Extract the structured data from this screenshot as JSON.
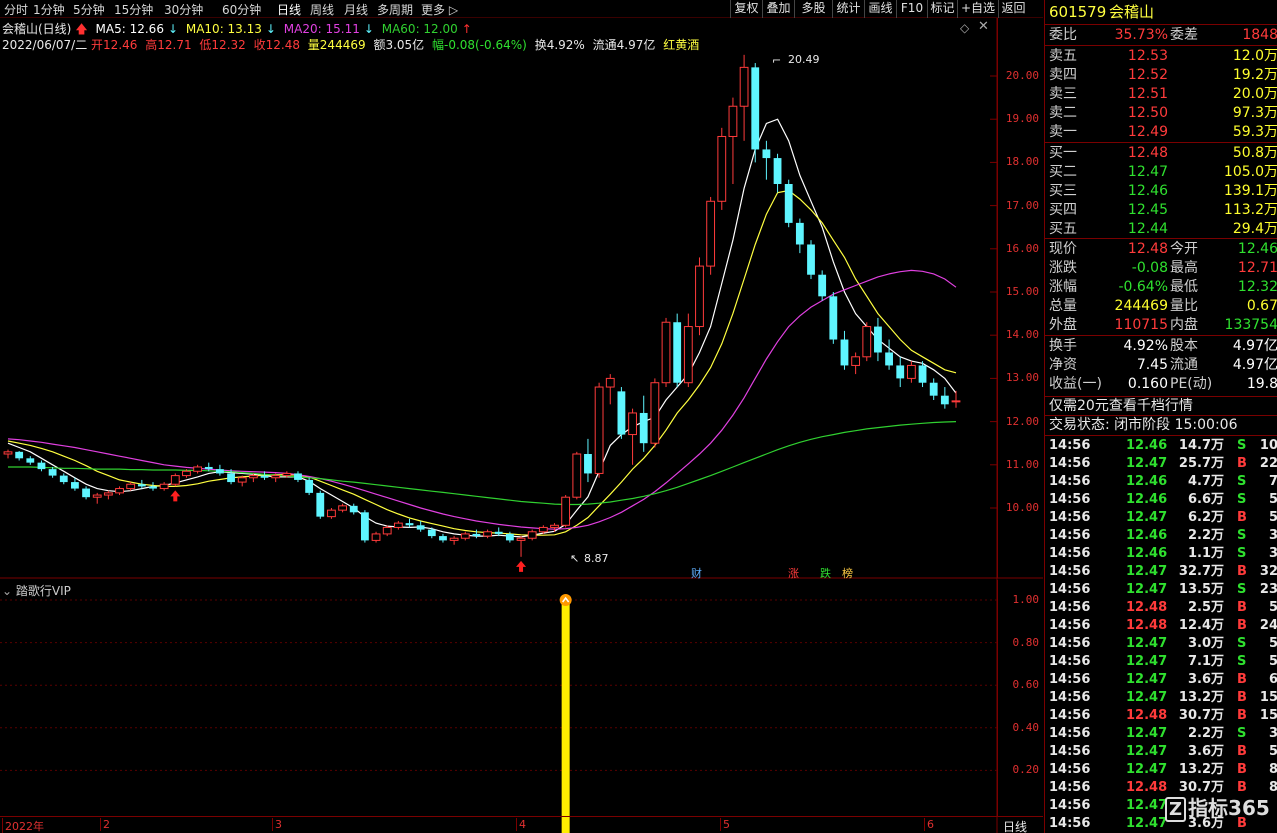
{
  "toolbar": {
    "periods": [
      "分时",
      "1分钟",
      "5分钟",
      "15分钟",
      "30分钟",
      "60分钟",
      "日线",
      "周线",
      "月线",
      "多周期",
      "更多"
    ],
    "active": "日线",
    "right_buttons": [
      "复权",
      "叠加",
      "多股",
      "统计",
      "画线",
      "F10",
      "标记",
      "+自选",
      "返回"
    ]
  },
  "info_line1": {
    "name": "会稽山(日线)",
    "ma5": "MA5: 12.66",
    "ma10": "MA10: 13.13",
    "ma20": "MA20: 15.11",
    "ma60": "MA60: 12.00"
  },
  "info_line2": {
    "date": "2022/06/07/二",
    "open": "开12.46",
    "high": "高12.71",
    "low": "低12.32",
    "close": "收12.48",
    "volume": "量244469",
    "amount": "额3.05亿",
    "change": "幅-0.08(-0.64%)",
    "turnover": "换4.92%",
    "float": "流通4.97亿",
    "concept": "红黄酒"
  },
  "price_axis": {
    "labels": [
      "20.00",
      "19.00",
      "18.00",
      "17.00",
      "16.00",
      "15.00",
      "14.00",
      "13.00",
      "12.00",
      "11.00",
      "10.00"
    ]
  },
  "annotations": {
    "high": "20.49",
    "low": "8.87",
    "events": [
      "财",
      "涨",
      "跌",
      "榜"
    ]
  },
  "indicator": {
    "name": "踏歌行VIP",
    "axis_labels": [
      "1.00",
      "0.80",
      "0.60",
      "0.40",
      "0.20"
    ]
  },
  "time_axis": {
    "labels": [
      "2022年",
      "2",
      "3",
      "4",
      "5",
      "6"
    ],
    "period": "日线"
  },
  "chart_data": {
    "type": "candlestick",
    "series_names": [
      "MA5",
      "MA10",
      "MA20",
      "MA60"
    ],
    "ylim": [
      8.6,
      20.8
    ],
    "candles": [
      [
        11.25,
        11.35,
        11.15,
        11.3
      ],
      [
        11.3,
        11.32,
        11.1,
        11.15
      ],
      [
        11.15,
        11.2,
        11.0,
        11.05
      ],
      [
        11.05,
        11.1,
        10.85,
        10.9
      ],
      [
        10.9,
        10.95,
        10.7,
        10.75
      ],
      [
        10.75,
        10.8,
        10.55,
        10.6
      ],
      [
        10.6,
        10.7,
        10.4,
        10.45
      ],
      [
        10.45,
        10.5,
        10.2,
        10.25
      ],
      [
        10.25,
        10.35,
        10.1,
        10.3
      ],
      [
        10.3,
        10.4,
        10.2,
        10.35
      ],
      [
        10.35,
        10.5,
        10.3,
        10.45
      ],
      [
        10.45,
        10.6,
        10.4,
        10.55
      ],
      [
        10.55,
        10.65,
        10.45,
        10.5
      ],
      [
        10.5,
        10.6,
        10.4,
        10.45
      ],
      [
        10.45,
        10.6,
        10.4,
        10.55
      ],
      [
        10.55,
        10.8,
        10.5,
        10.75
      ],
      [
        10.75,
        10.9,
        10.7,
        10.85
      ],
      [
        10.85,
        11.0,
        10.8,
        10.95
      ],
      [
        10.95,
        11.05,
        10.85,
        10.9
      ],
      [
        10.9,
        11.0,
        10.75,
        10.8
      ],
      [
        10.8,
        10.9,
        10.55,
        10.6
      ],
      [
        10.6,
        10.75,
        10.5,
        10.7
      ],
      [
        10.7,
        10.8,
        10.6,
        10.75
      ],
      [
        10.75,
        10.85,
        10.65,
        10.7
      ],
      [
        10.7,
        10.8,
        10.6,
        10.75
      ],
      [
        10.75,
        10.85,
        10.7,
        10.8
      ],
      [
        10.8,
        10.85,
        10.6,
        10.65
      ],
      [
        10.65,
        10.7,
        10.3,
        10.35
      ],
      [
        10.35,
        10.4,
        9.75,
        9.8
      ],
      [
        9.8,
        10.0,
        9.75,
        9.95
      ],
      [
        9.95,
        10.1,
        9.9,
        10.05
      ],
      [
        10.05,
        10.1,
        9.85,
        9.9
      ],
      [
        9.9,
        9.95,
        9.2,
        9.25
      ],
      [
        9.25,
        9.45,
        9.2,
        9.4
      ],
      [
        9.4,
        9.6,
        9.35,
        9.55
      ],
      [
        9.55,
        9.7,
        9.5,
        9.65
      ],
      [
        9.65,
        9.75,
        9.55,
        9.6
      ],
      [
        9.6,
        9.7,
        9.45,
        9.5
      ],
      [
        9.5,
        9.55,
        9.3,
        9.35
      ],
      [
        9.35,
        9.4,
        9.2,
        9.25
      ],
      [
        9.25,
        9.35,
        9.15,
        9.3
      ],
      [
        9.3,
        9.45,
        9.25,
        9.4
      ],
      [
        9.4,
        9.5,
        9.3,
        9.35
      ],
      [
        9.35,
        9.5,
        9.3,
        9.45
      ],
      [
        9.45,
        9.55,
        9.35,
        9.4
      ],
      [
        9.4,
        9.45,
        9.2,
        9.25
      ],
      [
        9.25,
        9.35,
        8.87,
        9.3
      ],
      [
        9.3,
        9.5,
        9.25,
        9.45
      ],
      [
        9.45,
        9.6,
        9.4,
        9.55
      ],
      [
        9.55,
        9.65,
        9.45,
        9.6
      ],
      [
        9.6,
        10.3,
        9.55,
        10.25
      ],
      [
        10.25,
        11.3,
        10.2,
        11.25
      ],
      [
        11.25,
        11.6,
        10.6,
        10.8
      ],
      [
        10.8,
        12.9,
        10.7,
        12.8
      ],
      [
        12.8,
        13.1,
        12.4,
        13.0
      ],
      [
        12.7,
        12.8,
        11.6,
        11.7
      ],
      [
        11.7,
        12.3,
        11.0,
        12.2
      ],
      [
        12.2,
        12.6,
        11.3,
        11.5
      ],
      [
        11.5,
        13.0,
        11.4,
        12.9
      ],
      [
        12.9,
        14.4,
        12.8,
        14.3
      ],
      [
        14.3,
        14.5,
        12.8,
        12.9
      ],
      [
        12.9,
        14.5,
        12.8,
        14.2
      ],
      [
        14.2,
        15.8,
        14.0,
        15.6
      ],
      [
        15.6,
        17.2,
        15.4,
        17.1
      ],
      [
        17.1,
        18.8,
        16.9,
        18.6
      ],
      [
        18.6,
        19.5,
        17.5,
        19.3
      ],
      [
        19.3,
        20.49,
        18.5,
        20.2
      ],
      [
        20.2,
        20.3,
        18.0,
        18.3
      ],
      [
        18.3,
        18.5,
        17.6,
        18.1
      ],
      [
        18.1,
        18.2,
        17.3,
        17.5
      ],
      [
        17.5,
        17.6,
        16.5,
        16.6
      ],
      [
        16.6,
        16.7,
        15.9,
        16.1
      ],
      [
        16.1,
        16.2,
        15.3,
        15.4
      ],
      [
        15.4,
        15.5,
        14.8,
        14.9
      ],
      [
        14.9,
        15.0,
        13.8,
        13.9
      ],
      [
        13.9,
        14.1,
        13.2,
        13.3
      ],
      [
        13.3,
        13.6,
        13.1,
        13.5
      ],
      [
        13.5,
        14.3,
        13.4,
        14.2
      ],
      [
        14.2,
        14.4,
        13.4,
        13.6
      ],
      [
        13.6,
        13.9,
        13.2,
        13.3
      ],
      [
        13.3,
        13.5,
        12.8,
        13.0
      ],
      [
        13.0,
        13.4,
        12.9,
        13.3
      ],
      [
        13.3,
        13.4,
        12.8,
        12.9
      ],
      [
        12.9,
        13.0,
        12.5,
        12.6
      ],
      [
        12.6,
        12.8,
        12.3,
        12.4
      ],
      [
        12.46,
        12.71,
        12.32,
        12.48
      ]
    ],
    "ma5": [
      11.5,
      11.4,
      11.3,
      11.15,
      11.0,
      10.85,
      10.7,
      10.55,
      10.45,
      10.4,
      10.38,
      10.4,
      10.45,
      10.5,
      10.52,
      10.58,
      10.65,
      10.72,
      10.8,
      10.84,
      10.82,
      10.8,
      10.78,
      10.75,
      10.72,
      10.72,
      10.72,
      10.62,
      10.45,
      10.3,
      10.15,
      10.0,
      9.8,
      9.65,
      9.58,
      9.56,
      9.55,
      9.56,
      9.52,
      9.45,
      9.4,
      9.37,
      9.35,
      9.35,
      9.37,
      9.35,
      9.33,
      9.37,
      9.42,
      9.46,
      9.62,
      9.95,
      10.26,
      10.85,
      11.45,
      11.7,
      11.88,
      12.0,
      12.1,
      12.5,
      12.8,
      13.1,
      13.6,
      14.2,
      15.2,
      16.2,
      17.4,
      18.3,
      18.9,
      19.0,
      18.5,
      17.7,
      17.1,
      16.5,
      15.7,
      15.0,
      14.5,
      14.2,
      13.9,
      13.7,
      13.5,
      13.4,
      13.35,
      13.2,
      13.0,
      12.66
    ],
    "ma10": [
      11.55,
      11.5,
      11.45,
      11.38,
      11.3,
      11.2,
      11.1,
      10.98,
      10.85,
      10.75,
      10.65,
      10.6,
      10.55,
      10.52,
      10.5,
      10.5,
      10.52,
      10.56,
      10.62,
      10.66,
      10.7,
      10.72,
      10.74,
      10.76,
      10.77,
      10.77,
      10.76,
      10.72,
      10.62,
      10.52,
      10.42,
      10.32,
      10.2,
      10.08,
      9.96,
      9.86,
      9.77,
      9.7,
      9.64,
      9.58,
      9.52,
      9.48,
      9.45,
      9.43,
      9.42,
      9.4,
      9.38,
      9.37,
      9.37,
      9.38,
      9.45,
      9.6,
      9.78,
      10.05,
      10.32,
      10.6,
      10.9,
      11.15,
      11.45,
      11.8,
      12.2,
      12.5,
      12.85,
      13.25,
      13.8,
      14.5,
      15.3,
      16.1,
      16.8,
      17.3,
      17.35,
      17.15,
      16.9,
      16.6,
      16.2,
      15.8,
      15.3,
      14.9,
      14.5,
      14.2,
      13.9,
      13.65,
      13.5,
      13.35,
      13.2,
      13.13
    ],
    "ma20": [
      11.6,
      11.58,
      11.55,
      11.52,
      11.48,
      11.44,
      11.4,
      11.35,
      11.3,
      11.25,
      11.2,
      11.15,
      11.1,
      11.05,
      11.0,
      10.97,
      10.94,
      10.92,
      10.9,
      10.88,
      10.86,
      10.85,
      10.84,
      10.83,
      10.82,
      10.8,
      10.77,
      10.73,
      10.68,
      10.62,
      10.55,
      10.48,
      10.4,
      10.32,
      10.24,
      10.16,
      10.08,
      10.0,
      9.93,
      9.86,
      9.8,
      9.75,
      9.7,
      9.66,
      9.62,
      9.59,
      9.56,
      9.54,
      9.52,
      9.51,
      9.52,
      9.55,
      9.6,
      9.68,
      9.78,
      9.9,
      10.05,
      10.2,
      10.38,
      10.58,
      10.8,
      11.02,
      11.25,
      11.5,
      11.8,
      12.15,
      12.55,
      13.0,
      13.45,
      13.85,
      14.2,
      14.45,
      14.65,
      14.8,
      14.95,
      15.05,
      15.15,
      15.25,
      15.35,
      15.42,
      15.47,
      15.5,
      15.48,
      15.42,
      15.3,
      15.11
    ],
    "ma60": [
      10.95,
      10.95,
      10.95,
      10.94,
      10.93,
      10.92,
      10.92,
      10.91,
      10.9,
      10.9,
      10.9,
      10.89,
      10.89,
      10.88,
      10.88,
      10.88,
      10.87,
      10.87,
      10.86,
      10.85,
      10.84,
      10.82,
      10.8,
      10.78,
      10.76,
      10.74,
      10.72,
      10.7,
      10.68,
      10.65,
      10.62,
      10.6,
      10.57,
      10.54,
      10.51,
      10.48,
      10.45,
      10.42,
      10.39,
      10.36,
      10.33,
      10.3,
      10.27,
      10.24,
      10.21,
      10.18,
      10.15,
      10.13,
      10.11,
      10.09,
      10.08,
      10.08,
      10.09,
      10.11,
      10.14,
      10.18,
      10.22,
      10.27,
      10.33,
      10.4,
      10.48,
      10.57,
      10.66,
      10.75,
      10.85,
      10.95,
      11.05,
      11.15,
      11.25,
      11.35,
      11.44,
      11.52,
      11.59,
      11.65,
      11.7,
      11.75,
      11.79,
      11.83,
      11.86,
      11.89,
      11.92,
      11.94,
      11.96,
      11.98,
      11.99,
      12.0
    ],
    "signal": {
      "index": 50,
      "value": 1.0
    }
  },
  "quote": {
    "code": "601579",
    "name": "会稽山",
    "weibi_label": "委比",
    "weibi": "35.73%",
    "weicha_label": "委差",
    "weicha": "1848",
    "asks": [
      [
        "卖五",
        "12.53",
        "12.0万"
      ],
      [
        "卖四",
        "12.52",
        "19.2万"
      ],
      [
        "卖三",
        "12.51",
        "20.0万"
      ],
      [
        "卖二",
        "12.50",
        "97.3万"
      ],
      [
        "卖一",
        "12.49",
        "59.3万"
      ]
    ],
    "bids": [
      [
        "买一",
        "12.48",
        "50.8万"
      ],
      [
        "买二",
        "12.47",
        "105.0万"
      ],
      [
        "买三",
        "12.46",
        "139.1万"
      ],
      [
        "买四",
        "12.45",
        "113.2万"
      ],
      [
        "买五",
        "12.44",
        "29.4万"
      ]
    ],
    "stats": [
      [
        "现价",
        "12.48",
        "今开",
        "12.46"
      ],
      [
        "涨跌",
        "-0.08",
        "最高",
        "12.71"
      ],
      [
        "涨幅",
        "-0.64%",
        "最低",
        "12.32"
      ],
      [
        "总量",
        "244469",
        "量比",
        "0.67"
      ],
      [
        "外盘",
        "110715",
        "内盘",
        "133754"
      ]
    ],
    "stats2": [
      [
        "换手",
        "4.92%",
        "股本",
        "4.97亿"
      ],
      [
        "净资",
        "7.45",
        "流通",
        "4.97亿"
      ],
      [
        "收益(一)",
        "0.160",
        "PE(动)",
        "19.8"
      ]
    ],
    "promo": "仅需20元查看千档行情",
    "status": "交易状态: 闭市阶段 15:00:06"
  },
  "ticks": [
    [
      "14:56",
      "12.46",
      "14.7万",
      "S",
      "10"
    ],
    [
      "14:56",
      "12.47",
      "25.7万",
      "B",
      "22"
    ],
    [
      "14:56",
      "12.46",
      "4.7万",
      "S",
      "7"
    ],
    [
      "14:56",
      "12.46",
      "6.6万",
      "S",
      "5"
    ],
    [
      "14:56",
      "12.47",
      "6.2万",
      "B",
      "5"
    ],
    [
      "14:56",
      "12.46",
      "2.2万",
      "S",
      "3"
    ],
    [
      "14:56",
      "12.46",
      "1.1万",
      "S",
      "3"
    ],
    [
      "14:56",
      "12.47",
      "32.7万",
      "B",
      "32"
    ],
    [
      "14:56",
      "12.47",
      "13.5万",
      "S",
      "23"
    ],
    [
      "14:56",
      "12.48",
      "2.5万",
      "B",
      "5"
    ],
    [
      "14:56",
      "12.48",
      "12.4万",
      "B",
      "24"
    ],
    [
      "14:56",
      "12.47",
      "3.0万",
      "S",
      "5"
    ],
    [
      "14:56",
      "12.47",
      "7.1万",
      "S",
      "5"
    ],
    [
      "14:56",
      "12.47",
      "3.6万",
      "B",
      "6"
    ],
    [
      "14:56",
      "12.47",
      "13.2万",
      "B",
      "15"
    ],
    [
      "14:56",
      "12.48",
      "30.7万",
      "B",
      "15"
    ],
    [
      "14:56",
      "12.47",
      "2.2万",
      "S",
      "3"
    ],
    [
      "14:56",
      "12.47",
      "3.6万",
      "B",
      "5"
    ],
    [
      "14:56",
      "12.47",
      "13.2万",
      "B",
      "8"
    ],
    [
      "14:56",
      "12.48",
      "30.7万",
      "B",
      "8"
    ],
    [
      "14:56",
      "12.47",
      "",
      "",
      ""
    ],
    [
      "14:56",
      "12.47",
      "3.6万",
      "B",
      ""
    ]
  ],
  "watermark": "指标365",
  "colors": {
    "up": "#ff3b3b",
    "down": "#5ff5ff",
    "ma5": "#ffffff",
    "ma10": "#ffff40",
    "ma20": "#e040e0",
    "ma60": "#30d030",
    "signal": "#ffee00"
  }
}
